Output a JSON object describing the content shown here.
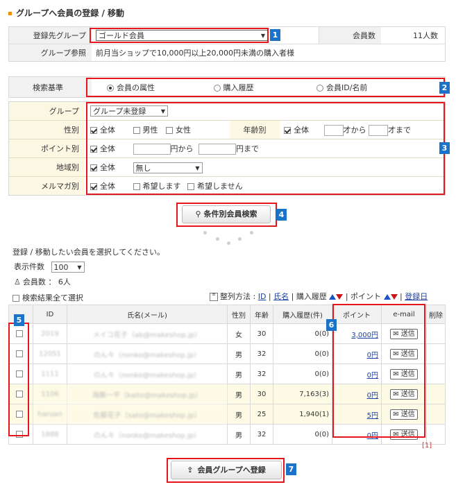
{
  "title": "グループへ会員の登録 / 移動",
  "group": {
    "label": "登録先グループ",
    "selected": "ゴールド会員",
    "count_label": "会員数",
    "count_value": "11人数",
    "ref_label": "グループ参照",
    "ref_value": "前月当ショップで10,000円以上20,000円未満の購入者様"
  },
  "criteria": {
    "label": "検索基準",
    "options": [
      "会員の属性",
      "購入履歴",
      "会員ID/名前"
    ]
  },
  "filters": {
    "group_label": "グループ",
    "group_value": "グループ未登録",
    "gender_label": "性別",
    "all": "全体",
    "male": "男性",
    "female": "女性",
    "age_label": "年齢別",
    "age_from": "才から",
    "age_to": "才まで",
    "point_label": "ポイント別",
    "point_from": "円から",
    "point_to": "円まで",
    "region_label": "地域別",
    "region_value": "無し",
    "mail_label": "メルマガ別",
    "mail_yes": "希望します",
    "mail_no": "希望しません"
  },
  "search_button": "条件別会員検索",
  "instruction": "登録 / 移動したい会員を選択してください。",
  "per_page_label": "表示件数",
  "per_page_value": "100",
  "member_count": "会員数 ： 6人",
  "select_all": "検索結果全て選択",
  "sort": {
    "label": "整列方法 :",
    "id": "ID",
    "name": "氏名",
    "purchase": "購入履歴",
    "point": "ポイント",
    "date": "登録日"
  },
  "table": {
    "headers": [
      "ID",
      "氏名(メール)",
      "性別",
      "年齢",
      "購入履歴(件)",
      "ポイント",
      "e-mail",
      "削除"
    ],
    "send_label": "送信",
    "rows": [
      {
        "id": "2019",
        "name": "メイコ花子（ab@makeshop.jp）",
        "gender": "女",
        "age": "30",
        "purchase": "0(0)",
        "point": "3,000円"
      },
      {
        "id": "12051",
        "name": "のん々（nonko@makeshop.jp）",
        "gender": "男",
        "age": "32",
        "purchase": "0(0)",
        "point": "0円"
      },
      {
        "id": "1111",
        "name": "のん々（nonko@makeshop.jp）",
        "gender": "男",
        "age": "32",
        "purchase": "0(0)",
        "point": "0円"
      },
      {
        "id": "1106",
        "name": "海藤一平（kaito@makeshop.jp）",
        "gender": "男",
        "age": "30",
        "purchase": "7,163(3)",
        "point": "0円"
      },
      {
        "id": "haruan",
        "name": "佐藤花子（sato@makeshop.jp）",
        "gender": "男",
        "age": "25",
        "purchase": "1,940(1)",
        "point": "5円"
      },
      {
        "id": "1888",
        "name": "のん々（nonko@makeshop.jp）",
        "gender": "男",
        "age": "32",
        "purchase": "0(0)",
        "point": "0円"
      }
    ]
  },
  "pager": "[1]",
  "register_button": "会員グループへ登録",
  "markers": [
    "1",
    "2",
    "3",
    "4",
    "5",
    "6",
    "7"
  ]
}
